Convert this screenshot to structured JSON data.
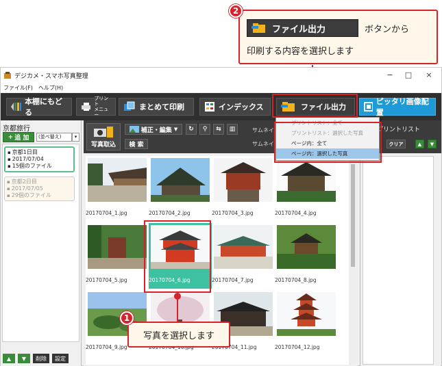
{
  "callout_top": {
    "badge": "2",
    "button_label": "ファイル出力",
    "text_after": "ボタンから",
    "line2": "印刷する内容を選択します"
  },
  "callout_bottom": {
    "badge": "1",
    "text": "写真を選択します"
  },
  "window": {
    "title": "デジカメ・スマホ写真整理",
    "minimize": "−",
    "maximize": "□",
    "close": "×",
    "menu": [
      "ファイル(F)",
      "ヘルプ(H)"
    ]
  },
  "toolbar": {
    "back": "本棚にもどる",
    "print_menu_line1": "プリント",
    "print_menu_line2": "メニュー",
    "batch_print": "まとめて印刷",
    "index": "インデックス",
    "file_export": "ファイル出力",
    "fit_layout": "ピッタリ画像配置"
  },
  "sidebar": {
    "title": "京都旅行",
    "add": "追 加",
    "sort": "(並べ替え)",
    "albums": [
      {
        "name": "京都1日目",
        "date": "2017/07/04",
        "count": "15個のファイル"
      },
      {
        "name": "京都2日目",
        "date": "2017/07/05",
        "count": "29個のファイル"
      }
    ],
    "up": "▲",
    "down": "▼",
    "delete": "削除",
    "settings": "設定"
  },
  "main_toolbar": {
    "import": "写真取込",
    "edit": "補正・編集",
    "search": "検 索",
    "thumb_label_1": "サムネイ",
    "thumb_label_2": "サムネイ"
  },
  "dropdown": {
    "items": [
      "プリントリスト：全て",
      "プリントリスト：選択した写真",
      "ページ内：全て",
      "ページ内：選択した写真"
    ]
  },
  "print_panel": {
    "title": "プリントリスト",
    "clear": "クリア"
  },
  "photos": [
    {
      "file": "20170704_1.jpg"
    },
    {
      "file": "20170704_2.jpg"
    },
    {
      "file": "20170704_3.jpg"
    },
    {
      "file": "20170704_4.jpg"
    },
    {
      "file": "20170704_5.jpg"
    },
    {
      "file": "20170704_6.jpg"
    },
    {
      "file": "20170704_7.jpg"
    },
    {
      "file": "20170704_8.jpg"
    },
    {
      "file": "20170704_9.jpg"
    },
    {
      "file": "20170704_10.jpg"
    },
    {
      "file": "20170704_11.jpg"
    },
    {
      "file": "20170704_12.jpg"
    }
  ],
  "colors": {
    "accent_red": "#d6232a",
    "selection_green": "#3cc2a0",
    "toolbar_dark": "#2f2f2f",
    "fit_blue": "#1e9ad6"
  }
}
